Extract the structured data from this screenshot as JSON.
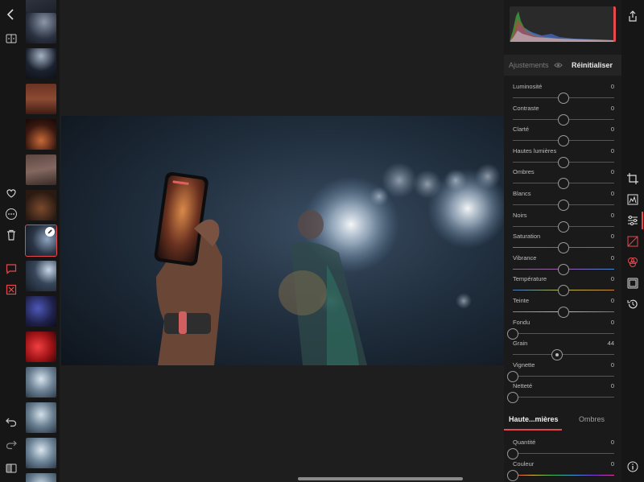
{
  "panel": {
    "tab_adjustments": "Ajustements",
    "reset_label": "Réinitialiser",
    "sliders": [
      {
        "label": "Luminosité",
        "value": "0",
        "position": 0.5
      },
      {
        "label": "Contraste",
        "value": "0",
        "position": 0.5
      },
      {
        "label": "Clarté",
        "value": "0",
        "position": 0.5
      },
      {
        "label": "Hautes lumières",
        "value": "0",
        "position": 0.5
      },
      {
        "label": "Ombres",
        "value": "0",
        "position": 0.5
      },
      {
        "label": "Blancs",
        "value": "0",
        "position": 0.5
      },
      {
        "label": "Noirs",
        "value": "0",
        "position": 0.5
      },
      {
        "label": "Saturation",
        "value": "0",
        "position": 0.5
      },
      {
        "label": "Vibrance",
        "value": "0",
        "position": 0.5
      },
      {
        "label": "Température",
        "value": "0",
        "position": 0.5
      },
      {
        "label": "Teinte",
        "value": "0",
        "position": 0.5
      },
      {
        "label": "Fondu",
        "value": "0",
        "position": 0.0
      },
      {
        "label": "Grain",
        "value": "44",
        "position": 0.44
      },
      {
        "label": "Vignette",
        "value": "0",
        "position": 0.0
      },
      {
        "label": "Netteté",
        "value": "0",
        "position": 0.0
      }
    ],
    "section_tabs": {
      "highlights": "Haute...mières",
      "shadows": "Ombres"
    },
    "split_toning": [
      {
        "label": "Quantité",
        "value": "0",
        "position": 0.0
      },
      {
        "label": "Couleur",
        "value": "0",
        "position": 0.0
      }
    ]
  },
  "colors": {
    "accent": "#e5484d",
    "panel_bg": "#1a1a1a",
    "canvas_bg": "#1e1e1e"
  },
  "left_toolbar_icons": [
    "back-icon",
    "compare-icon",
    "heart-icon",
    "more-icon",
    "trash-icon",
    "comment-icon",
    "reject-icon",
    "undo-icon",
    "redo-icon",
    "split-view-icon"
  ],
  "right_toolbar_icons": [
    "share-icon",
    "crop-icon",
    "histogram-icon",
    "adjust-icon",
    "curves-icon",
    "color-mix-icon",
    "frame-icon",
    "history-icon",
    "info-icon"
  ]
}
